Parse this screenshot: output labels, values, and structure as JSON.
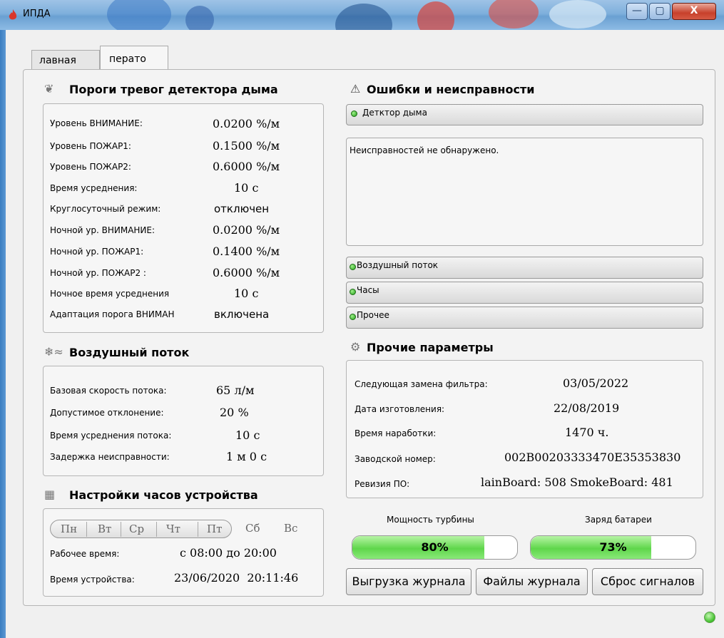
{
  "window": {
    "title": "ИПДА",
    "controls": {
      "minimize": "—",
      "maximize": "▢",
      "close": "X"
    }
  },
  "tabs": [
    {
      "label": "лавная"
    },
    {
      "label": "перато"
    }
  ],
  "alarm_thresholds": {
    "title": "Пороги тревог детектора дыма",
    "rows": [
      {
        "label": "Уровень ВНИМАНИЕ:",
        "value": "0.0200 %/м"
      },
      {
        "label": "Уровень ПОЖАР1:",
        "value": "0.1500 %/м"
      },
      {
        "label": "Уровень ПОЖАР2:",
        "value": "0.6000 %/м"
      },
      {
        "label": "Время усреднения:",
        "value": "10 с"
      },
      {
        "label": "Круглосуточный режим:",
        "value": "отключен"
      },
      {
        "label": "Ночной ур. ВНИМАНИЕ:",
        "value": "0.0200 %/м"
      },
      {
        "label": "Ночной ур. ПОЖАР1:",
        "value": "0.1400 %/м"
      },
      {
        "label": "Ночной ур. ПОЖАР2 :",
        "value": "0.6000 %/м"
      },
      {
        "label": "Ночное время усреднения",
        "value": "10 с"
      },
      {
        "label": "Адаптация порога ВНИМАН",
        "value": "включена"
      }
    ]
  },
  "airflow": {
    "title": "Воздушный поток",
    "rows": [
      {
        "label": "Базовая скорость потока:",
        "value": "65 л/м"
      },
      {
        "label": "Допустимое отклонение:",
        "value": "20 %"
      },
      {
        "label": "Время усреднения потока:",
        "value": "10 с"
      },
      {
        "label": "Задержка неисправности:",
        "value": "1 м 0 с"
      }
    ]
  },
  "clock": {
    "title": "Настройки часов устройства",
    "days": [
      "Пн",
      "Вт",
      "Ср",
      "Чт",
      "Пт",
      "Сб",
      "Вс"
    ],
    "work_time_label": "Рабочее время:",
    "work_time_value": "с 08:00 до 20:00",
    "device_time_label": "Время устройства:",
    "device_time_value": "23/06/2020  20:11:46"
  },
  "faults": {
    "title": "Ошибки и неисправности",
    "smoke_detector": "Детктор дыма",
    "message": "Неисправностей не обнаружено.",
    "airflow": "Воздушный поток",
    "clock": "Часы",
    "other": "Прочее"
  },
  "other_params": {
    "title": "Прочие параметры",
    "rows": [
      {
        "label": "Следующая замена фильтра:",
        "value": "03/05/2022"
      },
      {
        "label": "Дата изготовления:",
        "value": "22/08/2019"
      },
      {
        "label": "Время наработки:",
        "value": "1470 ч."
      },
      {
        "label": "Заводской номер:",
        "value": "002B00203333470E35353830"
      },
      {
        "label": "Ревизия ПО:",
        "value": "lainBoard: 508 SmokeBoard: 481"
      }
    ]
  },
  "turbine": {
    "label": "Мощность турбины",
    "text": "80%",
    "percent": 80
  },
  "battery": {
    "label": "Заряд батареи",
    "text": "73%",
    "percent": 73
  },
  "buttons": {
    "export_log": "Выгрузка журнала",
    "log_files": "Файлы журнала",
    "reset_signals": "Сброс сигналов"
  },
  "colors": {
    "status_ok": "#24a01a",
    "progress_fill": "#5fd64b",
    "close_button": "#c7402b"
  }
}
